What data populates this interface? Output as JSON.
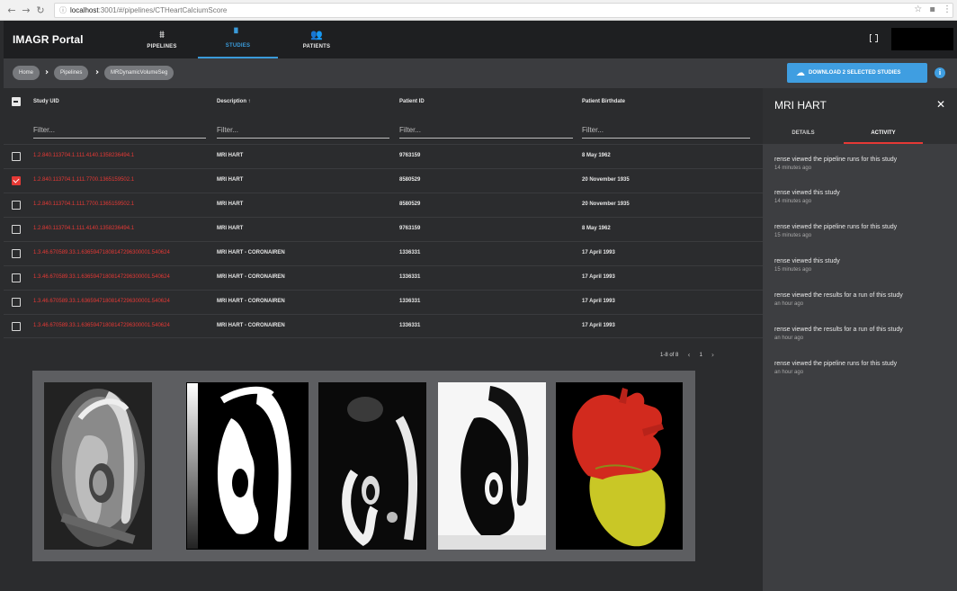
{
  "browser": {
    "url_host": "localhost",
    "url_path": ":3001/#/pipelines/CTHeartCalciumScore",
    "back_icon": "back-arrow-icon",
    "forward_icon": "forward-arrow-icon",
    "reload_icon": "reload-icon"
  },
  "app": {
    "brand": "IMAGR Portal",
    "nav": [
      {
        "label": "PIPELINES",
        "icon": "pipelines-icon"
      },
      {
        "label": "STUDIES",
        "icon": "studies-icon"
      },
      {
        "label": "PATIENTS",
        "icon": "patients-icon"
      }
    ]
  },
  "breadcrumb": [
    "Home",
    "Pipelines",
    "MRDynamicVolumeSeg"
  ],
  "download_button": "DOWNLOAD 2 SELECTED STUDIES",
  "table": {
    "columns": [
      "Study UID",
      "Description ↑",
      "Patient ID",
      "Patient Birthdate"
    ],
    "filter_placeholder": "Filter...",
    "rows": [
      {
        "uid": "1.2.840.113704.1.111.4140.1358236494.1",
        "desc": "MRI HART",
        "pid": "9763159",
        "dob": "8 May 1962",
        "checked": false
      },
      {
        "uid": "1.2.840.113704.1.111.7700.1365159502.1",
        "desc": "MRI HART",
        "pid": "8580529",
        "dob": "20 November 1935",
        "checked": true
      },
      {
        "uid": "1.2.840.113704.1.111.7700.1365159502.1",
        "desc": "MRI HART",
        "pid": "8580529",
        "dob": "20 November 1935",
        "checked": false
      },
      {
        "uid": "1.2.840.113704.1.111.4140.1358236494.1",
        "desc": "MRI HART",
        "pid": "9763159",
        "dob": "8 May 1962",
        "checked": false
      },
      {
        "uid": "1.3.46.670589.33.1.63659471808147296300001.540624",
        "desc": "MRI HART - CORONAIREN",
        "pid": "1336331",
        "dob": "17 April 1993",
        "checked": false
      },
      {
        "uid": "1.3.46.670589.33.1.63659471808147296300001.540624",
        "desc": "MRI HART - CORONAIREN",
        "pid": "1336331",
        "dob": "17 April 1993",
        "checked": false
      },
      {
        "uid": "1.3.46.670589.33.1.63659471808147296300001.540624",
        "desc": "MRI HART - CORONAIREN",
        "pid": "1336331",
        "dob": "17 April 1993",
        "checked": false
      },
      {
        "uid": "1.3.46.670589.33.1.63659471808147296300001.540624",
        "desc": "MRI HART - CORONAIREN",
        "pid": "1336331",
        "dob": "17 April 1993",
        "checked": false
      }
    ],
    "pager": {
      "range": "1-8 of 8",
      "page": "1"
    }
  },
  "panel": {
    "title": "MRI HART",
    "tabs": [
      "DETAILS",
      "ACTIVITY"
    ],
    "activity": [
      {
        "text": "rense viewed the pipeline runs for this study",
        "time": "14 minutes ago"
      },
      {
        "text": "rense viewed this study",
        "time": "14 minutes ago"
      },
      {
        "text": "rense viewed the pipeline runs for this study",
        "time": "15 minutes ago"
      },
      {
        "text": "rense viewed this study",
        "time": "15 minutes ago"
      },
      {
        "text": "rense viewed the results for a run of this study",
        "time": "an hour ago"
      },
      {
        "text": "rense viewed the results for a run of this study",
        "time": "an hour ago"
      },
      {
        "text": "rense viewed the pipeline runs for this study",
        "time": "an hour ago"
      }
    ]
  },
  "colors": {
    "accent": "#3f9ee1",
    "selection": "#e53935",
    "heart_top": "#d22a1e",
    "heart_bottom": "#c9c726"
  }
}
